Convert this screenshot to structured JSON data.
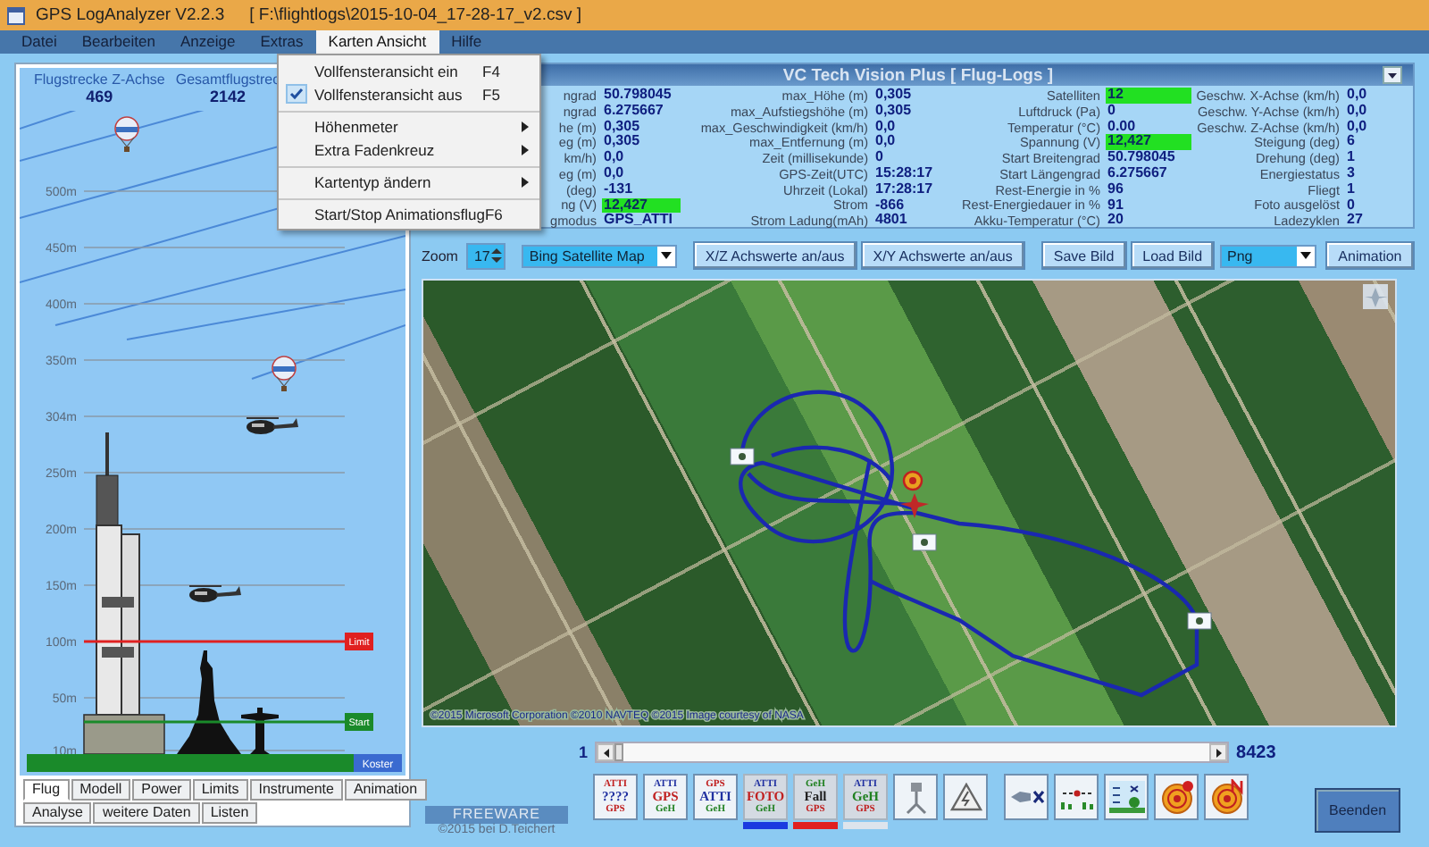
{
  "window": {
    "title": "GPS LogAnalyzer V2.2.3",
    "file": "[ F:\\flightlogs\\2015-10-04_17-28-17_v2.csv ]"
  },
  "menu": [
    {
      "label": "Datei",
      "selected": false
    },
    {
      "label": "Bearbeiten",
      "selected": false
    },
    {
      "label": "Anzeige",
      "selected": false
    },
    {
      "label": "Extras",
      "selected": false
    },
    {
      "label": "Karten Ansicht",
      "selected": true
    },
    {
      "label": "Hilfe",
      "selected": false
    }
  ],
  "dropdown": [
    {
      "label": "Vollfensteransicht ein",
      "shortcut": "F4",
      "checked": false,
      "submenu": false,
      "separator_before": false
    },
    {
      "label": "Vollfensteransicht aus",
      "shortcut": "F5",
      "checked": true,
      "submenu": false,
      "separator_before": false
    },
    {
      "label": "Höhenmeter",
      "checked": false,
      "submenu": true,
      "separator_before": true
    },
    {
      "label": "Extra Fadenkreuz",
      "checked": false,
      "submenu": true,
      "separator_before": false
    },
    {
      "label": "Kartentyp ändern",
      "checked": false,
      "submenu": true,
      "separator_before": true
    },
    {
      "label": "Start/Stop Animationsflug",
      "shortcut": "F6",
      "checked": false,
      "submenu": false,
      "separator_before": true
    }
  ],
  "altitude_panel": {
    "stats": [
      {
        "label": "Flugstrecke Z-Achse",
        "value": "469"
      },
      {
        "label": "Gesamtflugstrec",
        "value": "2142"
      }
    ],
    "scale": [
      "500m",
      "450m",
      "400m",
      "350m",
      "304m",
      "250m",
      "200m",
      "150m",
      "100m",
      "50m",
      "10m"
    ],
    "limit_tag": "Limit",
    "start_tag": "Start",
    "ground_tag": "Koster",
    "tab_rows": [
      [
        {
          "label": "Flug",
          "selected": true
        },
        {
          "label": "Modell",
          "selected": false
        },
        {
          "label": "Power",
          "selected": false
        },
        {
          "label": "Limits",
          "selected": false
        },
        {
          "label": "Instrumente",
          "selected": false
        },
        {
          "label": "Animation",
          "selected": false
        }
      ],
      [
        {
          "label": "Analyse",
          "selected": false
        },
        {
          "label": "weitere Daten",
          "selected": false
        },
        {
          "label": "Listen",
          "selected": false
        }
      ]
    ]
  },
  "log_panel": {
    "title": "VC Tech Vision Plus [ Flug-Logs ]",
    "columns": [
      [
        {
          "label": "ngrad",
          "value": "50.798045",
          "highlight": false
        },
        {
          "label": "ngrad",
          "value": "6.275667",
          "highlight": false
        },
        {
          "label": "he (m)",
          "value": "0,305",
          "highlight": false
        },
        {
          "label": "eg (m)",
          "value": "0,305",
          "highlight": false
        },
        {
          "label": "km/h)",
          "value": "0,0",
          "highlight": false
        },
        {
          "label": "eg (m)",
          "value": "0,0",
          "highlight": false
        },
        {
          "label": "(deg)",
          "value": "-131",
          "highlight": false
        },
        {
          "label": "ng (V)",
          "value": "12,427",
          "highlight": true
        },
        {
          "label": "gmodus",
          "value": "GPS_ATTI",
          "highlight": false
        }
      ],
      [
        {
          "label": "max_Höhe (m)",
          "value": "0,305",
          "highlight": false
        },
        {
          "label": "max_Aufstiegshöhe (m)",
          "value": "0,305",
          "highlight": false
        },
        {
          "label": "max_Geschwindigkeit (km/h)",
          "value": "0,0",
          "highlight": false
        },
        {
          "label": "max_Entfernung (m)",
          "value": "0,0",
          "highlight": false
        },
        {
          "label": "Zeit (millisekunde)",
          "value": "0",
          "highlight": false
        },
        {
          "label": "GPS-Zeit(UTC)",
          "value": "15:28:17",
          "highlight": false
        },
        {
          "label": "Uhrzeit (Lokal)",
          "value": "17:28:17",
          "highlight": false
        },
        {
          "label": "Strom",
          "value": "-866",
          "highlight": false
        },
        {
          "label": "Strom Ladung(mAh)",
          "value": "4801",
          "highlight": false
        }
      ],
      [
        {
          "label": "Satelliten",
          "value": "12",
          "highlight": true
        },
        {
          "label": "Luftdruck (Pa)",
          "value": "0",
          "highlight": false
        },
        {
          "label": "Temperatur (°C)",
          "value": "0.00",
          "highlight": false
        },
        {
          "label": "Spannung (V)",
          "value": "12,427",
          "highlight": true
        },
        {
          "label": "Start Breitengrad",
          "value": "50.798045",
          "highlight": false
        },
        {
          "label": "Start Längengrad",
          "value": "6.275667",
          "highlight": false
        },
        {
          "label": "Rest-Energie in %",
          "value": "96",
          "highlight": false
        },
        {
          "label": "Rest-Energiedauer in %",
          "value": "91",
          "highlight": false
        },
        {
          "label": "Akku-Temperatur (°C)",
          "value": "20",
          "highlight": false
        }
      ],
      [
        {
          "label": "Geschw. X-Achse (km/h)",
          "value": "0,0",
          "highlight": false
        },
        {
          "label": "Geschw. Y-Achse (km/h)",
          "value": "0,0",
          "highlight": false
        },
        {
          "label": "Geschw. Z-Achse (km/h)",
          "value": "0,0",
          "highlight": false
        },
        {
          "label": "Steigung (deg)",
          "value": "6",
          "highlight": false
        },
        {
          "label": "Drehung (deg)",
          "value": "1",
          "highlight": false
        },
        {
          "label": "Energiestatus",
          "value": "3",
          "highlight": false
        },
        {
          "label": "Fliegt",
          "value": "1",
          "highlight": false
        },
        {
          "label": "Foto ausgelöst",
          "value": "0",
          "highlight": false
        },
        {
          "label": "Ladezyklen",
          "value": "27",
          "highlight": false
        }
      ]
    ]
  },
  "toolbar": {
    "zoom_label": "Zoom",
    "zoom_value": "17",
    "map_type": "Bing Satellite Map",
    "axis_buttons": [
      "X/Z Achswerte an/aus",
      "X/Y Achswerte an/aus"
    ],
    "image_buttons": [
      "Save Bild",
      "Load Bild"
    ],
    "format": "Png",
    "animation_button": "Animation"
  },
  "map": {
    "copyright": "©2015 Microsoft Corporation  ©2010 NAVTEQ  ©2015 Image courtesy of NASA"
  },
  "timeline": {
    "start": "1",
    "end": "8423",
    "level": 0
  },
  "tools": [
    {
      "kind": "label",
      "disabled": false,
      "lines": [
        {
          "text": "ATTI",
          "color": "#c02020"
        },
        {
          "text": "????",
          "color": "#2030a0"
        },
        {
          "text": "GPS",
          "color": "#c02020"
        }
      ]
    },
    {
      "kind": "label",
      "disabled": false,
      "lines": [
        {
          "text": "ATTI",
          "color": "#2030a0"
        },
        {
          "text": "GPS",
          "color": "#c02020"
        },
        {
          "text": "GeH",
          "color": "#208020"
        }
      ]
    },
    {
      "kind": "label",
      "disabled": false,
      "lines": [
        {
          "text": "GPS",
          "color": "#c02020"
        },
        {
          "text": "ATTI",
          "color": "#2030a0"
        },
        {
          "text": "GeH",
          "color": "#208020"
        }
      ]
    },
    {
      "kind": "label",
      "disabled": true,
      "color": "#1a3ae0",
      "lines": [
        {
          "text": "ATTI",
          "color": "#2030a0"
        },
        {
          "text": "FOTO",
          "color": "#c02020"
        },
        {
          "text": "GeH",
          "color": "#208020"
        }
      ]
    },
    {
      "kind": "label",
      "disabled": true,
      "color": "#e02020",
      "lines": [
        {
          "text": "GeH",
          "color": "#208020"
        },
        {
          "text": "Fall",
          "color": "#202020"
        },
        {
          "text": "GPS",
          "color": "#c02020"
        }
      ]
    },
    {
      "kind": "label",
      "disabled": true,
      "color": "#dde4ec",
      "lines": [
        {
          "text": "ATTI",
          "color": "#2030a0"
        },
        {
          "text": "GeH",
          "color": "#208020"
        },
        {
          "text": "GPS",
          "color": "#c02020"
        }
      ]
    },
    {
      "kind": "tripod",
      "disabled": false
    },
    {
      "kind": "warning",
      "disabled": false
    },
    {
      "kind": "drone",
      "disabled": false
    },
    {
      "kind": "route",
      "disabled": false
    },
    {
      "kind": "landscape",
      "disabled": false
    },
    {
      "kind": "target",
      "disabled": false
    },
    {
      "kind": "target-north",
      "disabled": false
    }
  ],
  "footer": {
    "license": "FREEWARE",
    "credit": "©2015 bei D.Teichert",
    "exit_button": "Beenden"
  }
}
